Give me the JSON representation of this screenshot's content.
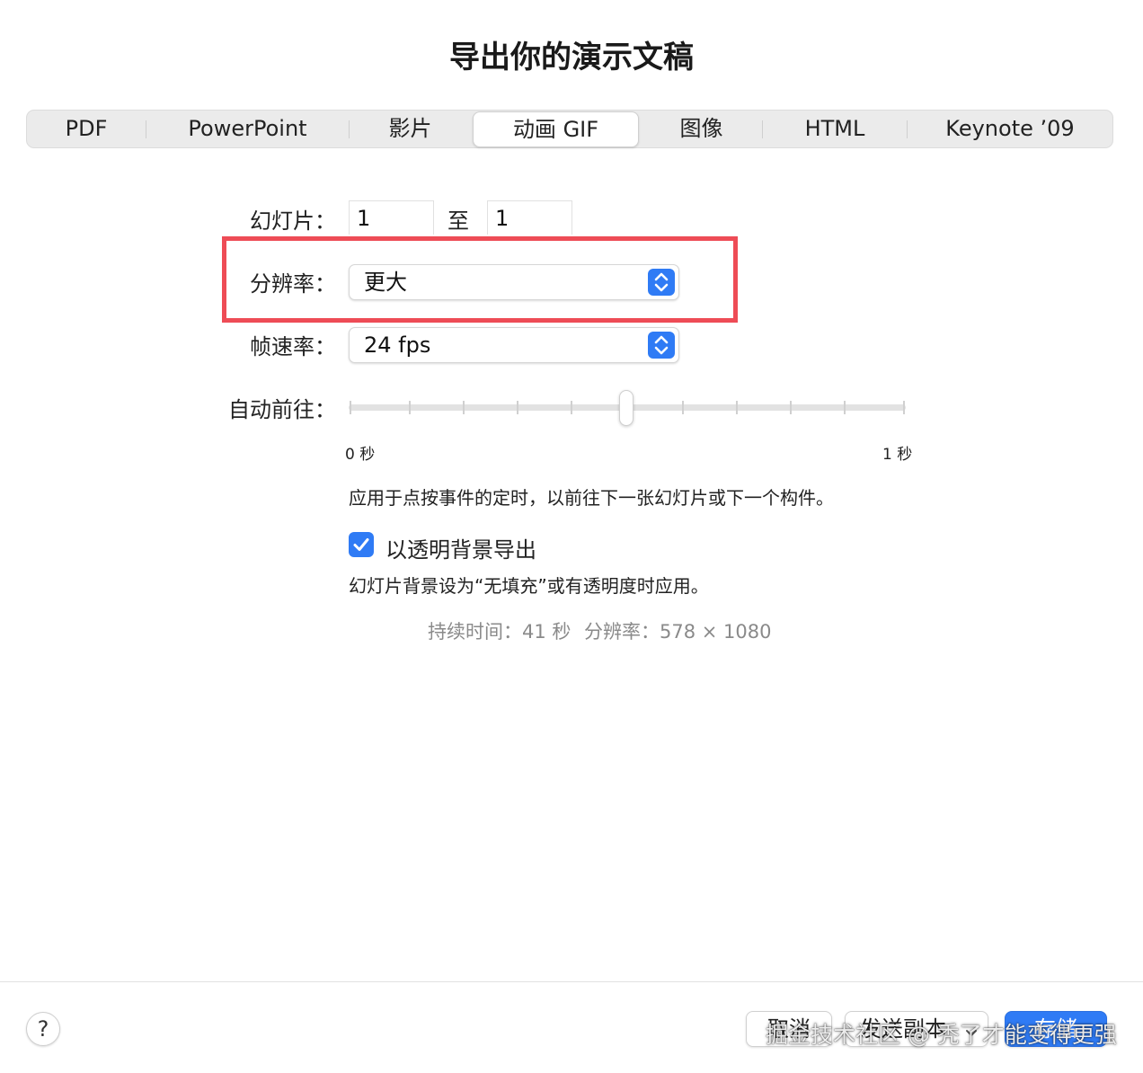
{
  "dialog": {
    "title": "导出你的演示文稿"
  },
  "tabs": [
    {
      "label": "PDF"
    },
    {
      "label": "PowerPoint"
    },
    {
      "label": "影片"
    },
    {
      "label": "动画 GIF"
    },
    {
      "label": "图像"
    },
    {
      "label": "HTML"
    },
    {
      "label": "Keynote ’09"
    }
  ],
  "active_tab": "动画 GIF",
  "slides": {
    "label": "幻灯片：",
    "from": "1",
    "to_label": "至",
    "to": "1"
  },
  "resolution": {
    "label": "分辨率：",
    "value": "更大"
  },
  "frame_rate": {
    "label": "帧速率：",
    "value": "24 fps"
  },
  "auto_advance": {
    "label": "自动前往：",
    "min_label": "0 秒",
    "max_label": "1 秒",
    "value_fraction": 0.5,
    "description": "应用于点按事件的定时，以前往下一张幻灯片或下一个构件。"
  },
  "transparent": {
    "checked": true,
    "label": "以透明背景导出",
    "description": "幻灯片背景设为“无填充”或有透明度时应用。"
  },
  "info": {
    "duration": "持续时间：41 秒",
    "resolution": "分辨率：578 × 1080"
  },
  "footer": {
    "help": "?",
    "cancel": "取消",
    "send_copy": "发送副本",
    "save": "存储"
  },
  "watermark": "掘金技术社区 @ 秃了才能变得更强",
  "colors": {
    "accent": "#2f7bf5",
    "highlight": "#ee4c56"
  }
}
